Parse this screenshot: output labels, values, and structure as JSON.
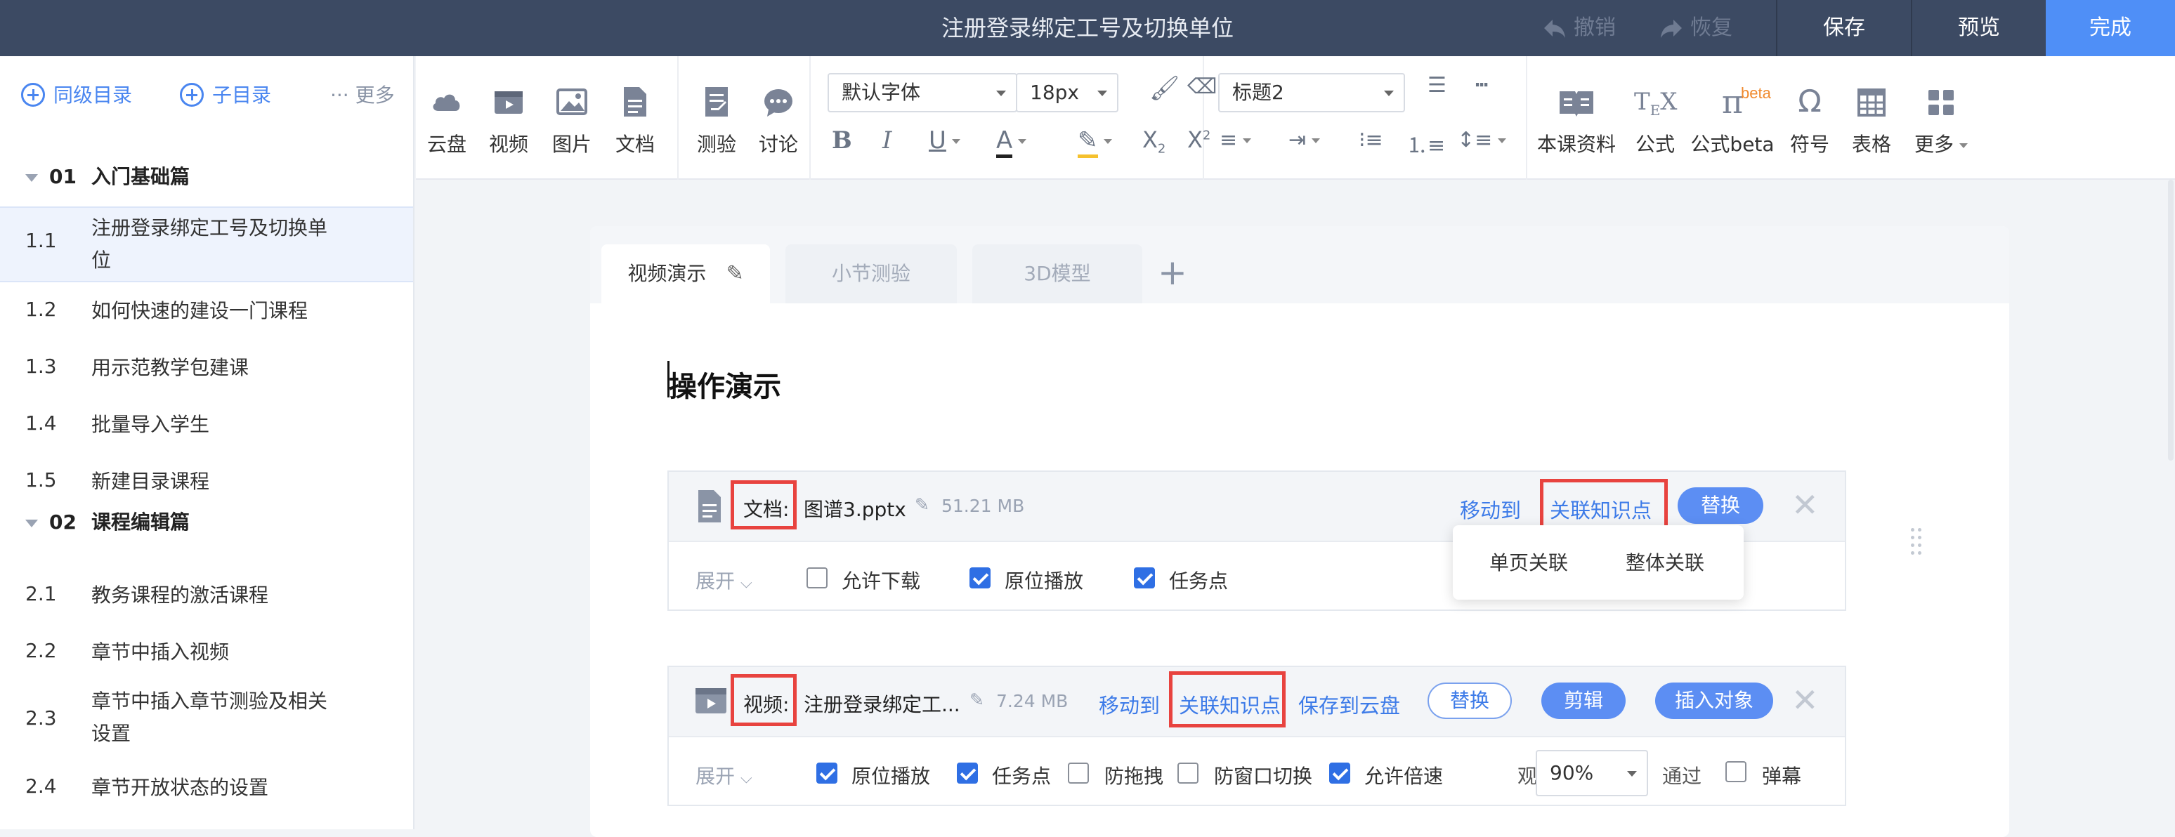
{
  "topbar": {
    "title": "注册登录绑定工号及切换单位",
    "undo": "撤销",
    "redo": "恢复",
    "save": "保存",
    "preview": "预览",
    "done": "完成"
  },
  "sidebar": {
    "add_sibling": "同级目录",
    "add_child": "子目录",
    "more": "··· 更多",
    "sections": [
      {
        "num": "01",
        "title": "入门基础篇"
      },
      {
        "num": "02",
        "title": "课程编辑篇"
      }
    ],
    "items": [
      {
        "num": "1.1",
        "label": "注册登录绑定工号及切换单位"
      },
      {
        "num": "1.2",
        "label": "如何快速的建设一门课程"
      },
      {
        "num": "1.3",
        "label": "用示范教学包建课"
      },
      {
        "num": "1.4",
        "label": "批量导入学生"
      },
      {
        "num": "1.5",
        "label": "新建目录课程"
      },
      {
        "num": "2.1",
        "label": "教务课程的激活课程"
      },
      {
        "num": "2.2",
        "label": "章节中插入视频"
      },
      {
        "num": "2.3",
        "label": "章节中插入章节测验及相关设置"
      },
      {
        "num": "2.4",
        "label": "章节开放状态的设置"
      }
    ]
  },
  "toolbar": {
    "cloud": "云盘",
    "video": "视频",
    "image": "图片",
    "doc": "文档",
    "quiz": "测验",
    "discuss": "讨论",
    "font": "默认字体",
    "size": "18px",
    "heading": "标题2",
    "materials": "本课资料",
    "formula": "公式",
    "formula_beta": "公式beta",
    "beta_tag": "beta",
    "symbol": "符号",
    "table": "表格",
    "more": "更多"
  },
  "tabs": [
    "视频演示",
    "小节测验",
    "3D模型"
  ],
  "content": {
    "heading": "操作演示",
    "doc_card": {
      "type": "文档:",
      "name": "图谱3.pptx",
      "size": "51.21 MB",
      "move": "移动到",
      "link_kp": "关联知识点",
      "replace": "替换",
      "expand": "展开",
      "options": [
        "允许下载",
        "原位播放",
        "任务点"
      ],
      "checked": [
        false,
        true,
        true
      ],
      "popup": [
        "单页关联",
        "整体关联"
      ]
    },
    "video_card": {
      "type": "视频:",
      "name": "注册登录绑定工...",
      "size": "7.24 MB",
      "move": "移动到",
      "link_kp": "关联知识点",
      "save_cloud": "保存到云盘",
      "replace": "替换",
      "edit": "剪辑",
      "insert": "插入对象",
      "expand": "展开",
      "options": [
        "原位播放",
        "任务点",
        "防拖拽",
        "防窗口切换",
        "允许倍速"
      ],
      "checked": [
        true,
        true,
        false,
        false,
        true
      ],
      "watch_label": "观看",
      "watch_value": "90%",
      "pass_label": "通过",
      "danmaku_label": "弹幕"
    }
  },
  "colors": {
    "topbar": "#3c4a63",
    "accent": "#4f8ff7",
    "highlight": "#e8433f"
  }
}
